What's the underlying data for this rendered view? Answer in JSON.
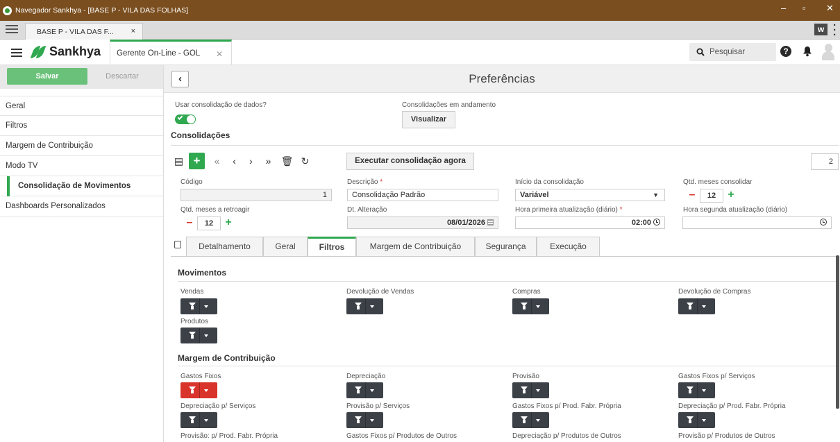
{
  "window": {
    "title": "Navegador Sankhya - [BASE P - VILA DAS FOLHAS]"
  },
  "browser_tab": {
    "label": "BASE P - VILA DAS F...",
    "close": "×"
  },
  "app": {
    "brand": "Sankhya",
    "tab_label": "Gerente On-Line - GOL",
    "search_placeholder": "Pesquisar"
  },
  "sidebar": {
    "save_label": "Salvar",
    "discard_label": "Descartar",
    "items": [
      {
        "label": "Geral"
      },
      {
        "label": "Filtros"
      },
      {
        "label": "Margem de Contribuição"
      },
      {
        "label": "Modo TV"
      },
      {
        "label": "Consolidação de Movimentos"
      },
      {
        "label": "Dashboards Personalizados"
      }
    ]
  },
  "page": {
    "title": "Preferências",
    "use_consolidation_label": "Usar consolidação de dados?",
    "use_consolidation_on": true,
    "in_progress_label": "Consolidações em andamento",
    "view_button": "Visualizar",
    "section_title": "Consolidações",
    "exec_button": "Executar consolidação agora",
    "page_count": "2",
    "accent_color": "#2fa84f",
    "danger_color": "#d9342b"
  },
  "form": {
    "codigo": {
      "label": "Código",
      "value": "1"
    },
    "descricao": {
      "label": "Descrição",
      "value": "Consolidação Padrão"
    },
    "inicio": {
      "label": "Início da consolidação",
      "value": "Variável"
    },
    "qtd_consolidar": {
      "label": "Qtd. meses consolidar",
      "value": "12"
    },
    "qtd_retroagir": {
      "label": "Qtd. meses a retroagir",
      "value": "12"
    },
    "dt_alteracao": {
      "label": "Dt. Alteração",
      "value": "08/01/2026"
    },
    "hora1": {
      "label": "Hora primeira atualização (diário)",
      "value": "02:00"
    },
    "hora2": {
      "label": "Hora segunda atualização (diário)",
      "value": ""
    },
    "required_mark": "*"
  },
  "detail_tabs": [
    "Detalhamento",
    "Geral",
    "Filtros",
    "Margem de Contribuição",
    "Segurança",
    "Execução"
  ],
  "filters": {
    "movimentos_title": "Movimentos",
    "movimentos": [
      "Vendas",
      "Devolução de Vendas",
      "Compras",
      "Devolução de Compras",
      "Produtos"
    ],
    "margem_title": "Margem de Contribuição",
    "margem": [
      "Gastos Fixos",
      "Depreciação",
      "Provisão",
      "Gastos Fixos p/ Serviços",
      "Depreciação p/ Serviços",
      "Provisão p/ Serviços",
      "Gastos Fixos p/ Prod. Fabr. Própria",
      "Depreciação p/ Prod. Fabr. Própria",
      "Provisão: p/ Prod. Fabr. Própria",
      "Gastos Fixos p/ Produtos de Outros",
      "Depreciação p/ Produtos de Outros",
      "Provisão p/ Produtos de Outros"
    ]
  }
}
